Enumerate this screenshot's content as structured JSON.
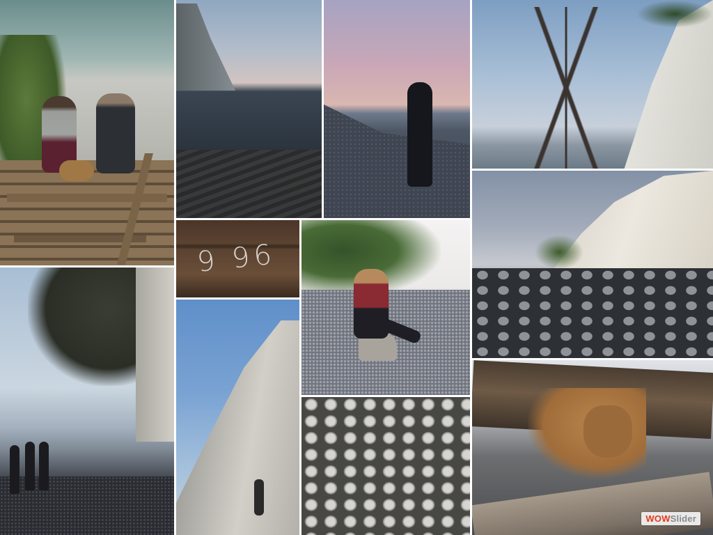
{
  "collage": {
    "tiles": [
      {
        "id": "stairs-beach"
      },
      {
        "id": "cliff-dusk-sea"
      },
      {
        "id": "man-silhouette"
      },
      {
        "id": "cliff-with-tree"
      },
      {
        "id": "wood-board-number",
        "text": "9 96"
      },
      {
        "id": "woman-on-rock"
      },
      {
        "id": "cliff-boulders"
      },
      {
        "id": "overhang-roots-shore"
      },
      {
        "id": "tall-white-cliff"
      },
      {
        "id": "pebbles-closeup"
      },
      {
        "id": "dog-under-log"
      }
    ]
  },
  "watermark": {
    "brand_part1": "WOW",
    "brand_part2": "Slider",
    "colors": {
      "primary": "#e23a1a",
      "secondary": "#8a8a8a",
      "background": "#e9e9e9"
    }
  }
}
